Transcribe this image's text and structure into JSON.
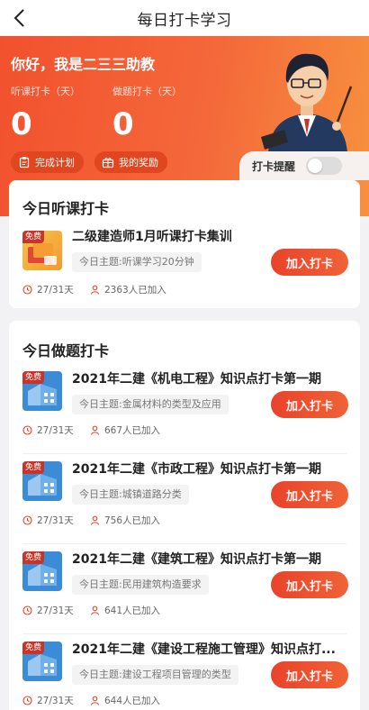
{
  "nav": {
    "title": "每日打卡学习"
  },
  "hero": {
    "greeting": "你好，我是二三三助教",
    "listen_label": "听课打卡（天）",
    "listen_value": "0",
    "practice_label": "做题打卡（天）",
    "practice_value": "0",
    "plan_button": "完成计划",
    "reward_button": "我的奖励",
    "remind_label": "打卡提醒",
    "remind_on": false
  },
  "listen_section": {
    "title": "今日听课打卡",
    "items": [
      {
        "badge": "免费",
        "title": "二级建造师1月听课打卡集训",
        "topic": "今日主题:听课学习20分钟",
        "progress": "27/31天",
        "joined": "2363人已加入",
        "button": "加入打卡"
      }
    ]
  },
  "practice_section": {
    "title": "今日做题打卡",
    "items": [
      {
        "badge": "免费",
        "title": "2021年二建《机电工程》知识点打卡第一期",
        "topic": "今日主题:金属材料的类型及应用",
        "progress": "27/31天",
        "joined": "667人已加入",
        "button": "加入打卡"
      },
      {
        "badge": "免费",
        "title": "2021年二建《市政工程》知识点打卡第一期",
        "topic": "今日主题:城镇道路分类",
        "progress": "27/31天",
        "joined": "756人已加入",
        "button": "加入打卡"
      },
      {
        "badge": "免费",
        "title": "2021年二建《建筑工程》知识点打卡第一期",
        "topic": "今日主题:民用建筑构造要求",
        "progress": "27/31天",
        "joined": "641人已加入",
        "button": "加入打卡"
      },
      {
        "badge": "免费",
        "title": "2021年二建《建设工程施工管理》知识点打...",
        "topic": "今日主题:建设工程项目管理的类型",
        "progress": "27/31天",
        "joined": "644人已加入",
        "button": "加入打卡"
      }
    ]
  },
  "colors": {
    "accent": "#f2512e",
    "button": "#e8432b",
    "badge": "#c8342a"
  }
}
